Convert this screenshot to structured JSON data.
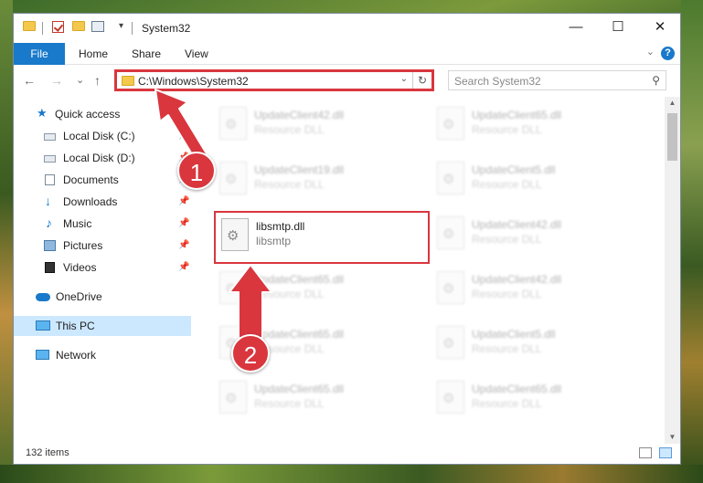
{
  "window": {
    "title": "System32",
    "qat_dropdown": "▾",
    "controls": {
      "minimize": "—",
      "maximize": "☐",
      "close": "✕"
    }
  },
  "ribbon": {
    "tabs": [
      "File",
      "Home",
      "Share",
      "View"
    ],
    "expand": "⌄",
    "help": "?"
  },
  "nav": {
    "back": "←",
    "forward": "→",
    "recent": "⌄",
    "up": "↑",
    "address": "C:\\Windows\\System32",
    "address_dropdown": "⌄",
    "refresh": "↻",
    "search_placeholder": "Search System32",
    "search_icon": "⚲"
  },
  "sidebar": {
    "items": [
      {
        "label": "Quick access",
        "icon": "star-icon",
        "pinned": false
      },
      {
        "label": "Local Disk (C:)",
        "icon": "drive-icon",
        "pinned": true
      },
      {
        "label": "Local Disk (D:)",
        "icon": "drive-icon",
        "pinned": true
      },
      {
        "label": "Documents",
        "icon": "documents-icon",
        "pinned": true
      },
      {
        "label": "Downloads",
        "icon": "downloads-icon",
        "pinned": true
      },
      {
        "label": "Music",
        "icon": "music-icon",
        "pinned": true
      },
      {
        "label": "Pictures",
        "icon": "pictures-icon",
        "pinned": true
      },
      {
        "label": "Videos",
        "icon": "videos-icon",
        "pinned": true
      },
      {
        "label": "OneDrive",
        "icon": "onedrive-icon",
        "pinned": false
      },
      {
        "label": "This PC",
        "icon": "this-pc-icon",
        "pinned": false,
        "selected": true
      },
      {
        "label": "Network",
        "icon": "network-icon",
        "pinned": false
      }
    ],
    "pin_glyph": "📌"
  },
  "files": [
    {
      "name": "UpdateClient42.dll",
      "type": "Resource DLL"
    },
    {
      "name": "UpdateClient65.dll",
      "type": "Resource DLL"
    },
    {
      "name": "UpdateClient19.dll",
      "type": "Resource DLL"
    },
    {
      "name": "UpdateClient5.dll",
      "type": "Resource DLL"
    },
    {
      "name": "libsmtp.dll",
      "type": "libsmtp"
    },
    {
      "name": "UpdateClient42.dll",
      "type": "Resource DLL"
    },
    {
      "name": "UpdateClient65.dll",
      "type": "Resource DLL"
    },
    {
      "name": "UpdateClient42.dll",
      "type": "Resource DLL"
    },
    {
      "name": "UpdateClient65.dll",
      "type": "Resource DLL"
    },
    {
      "name": "UpdateClient5.dll",
      "type": "Resource DLL"
    },
    {
      "name": "UpdateClient65.dll",
      "type": "Resource DLL"
    },
    {
      "name": "UpdateClient65.dll",
      "type": "Resource DLL"
    }
  ],
  "status": {
    "item_count": "132 items"
  },
  "annotations": {
    "step1": "1",
    "step2": "2",
    "color": "#d9363e"
  }
}
